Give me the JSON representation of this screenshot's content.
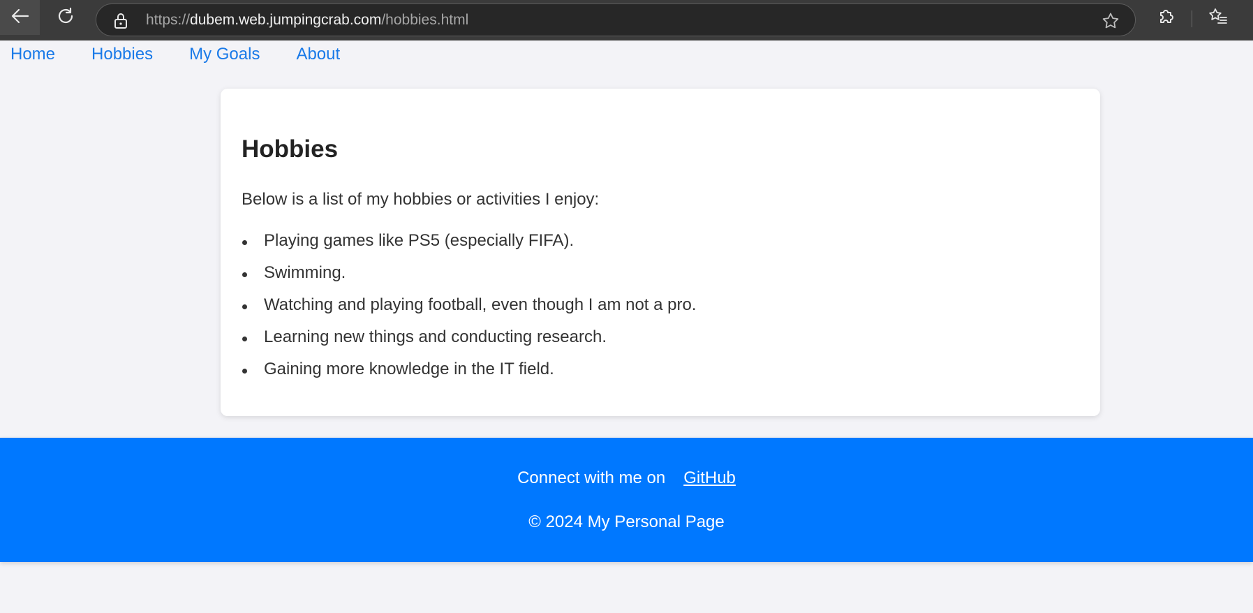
{
  "browser": {
    "url_scheme": "https://",
    "url_host": "dubem.web.jumpingcrab.com",
    "url_path": "/hobbies.html",
    "icons": [
      "back-arrow-icon",
      "reload-icon",
      "lock-icon",
      "star-icon",
      "extensions-icon",
      "favorites-icon"
    ]
  },
  "nav": {
    "items": [
      "Home",
      "Hobbies",
      "My Goals",
      "About"
    ],
    "link_color": "#1a7ae8"
  },
  "main": {
    "title": "Hobbies",
    "intro": "Below is a list of my hobbies or activities I enjoy:",
    "hobbies": [
      "Playing games like PS5 (especially FIFA).",
      "Swimming.",
      "Watching and playing football, even though I am not a pro.",
      "Learning new things and conducting research.",
      "Gaining more knowledge in the IT field."
    ]
  },
  "footer": {
    "connect_text": "Connect with me on",
    "github_label": "GitHub",
    "copyright": "© 2024 My Personal Page",
    "background": "#0078ff"
  }
}
